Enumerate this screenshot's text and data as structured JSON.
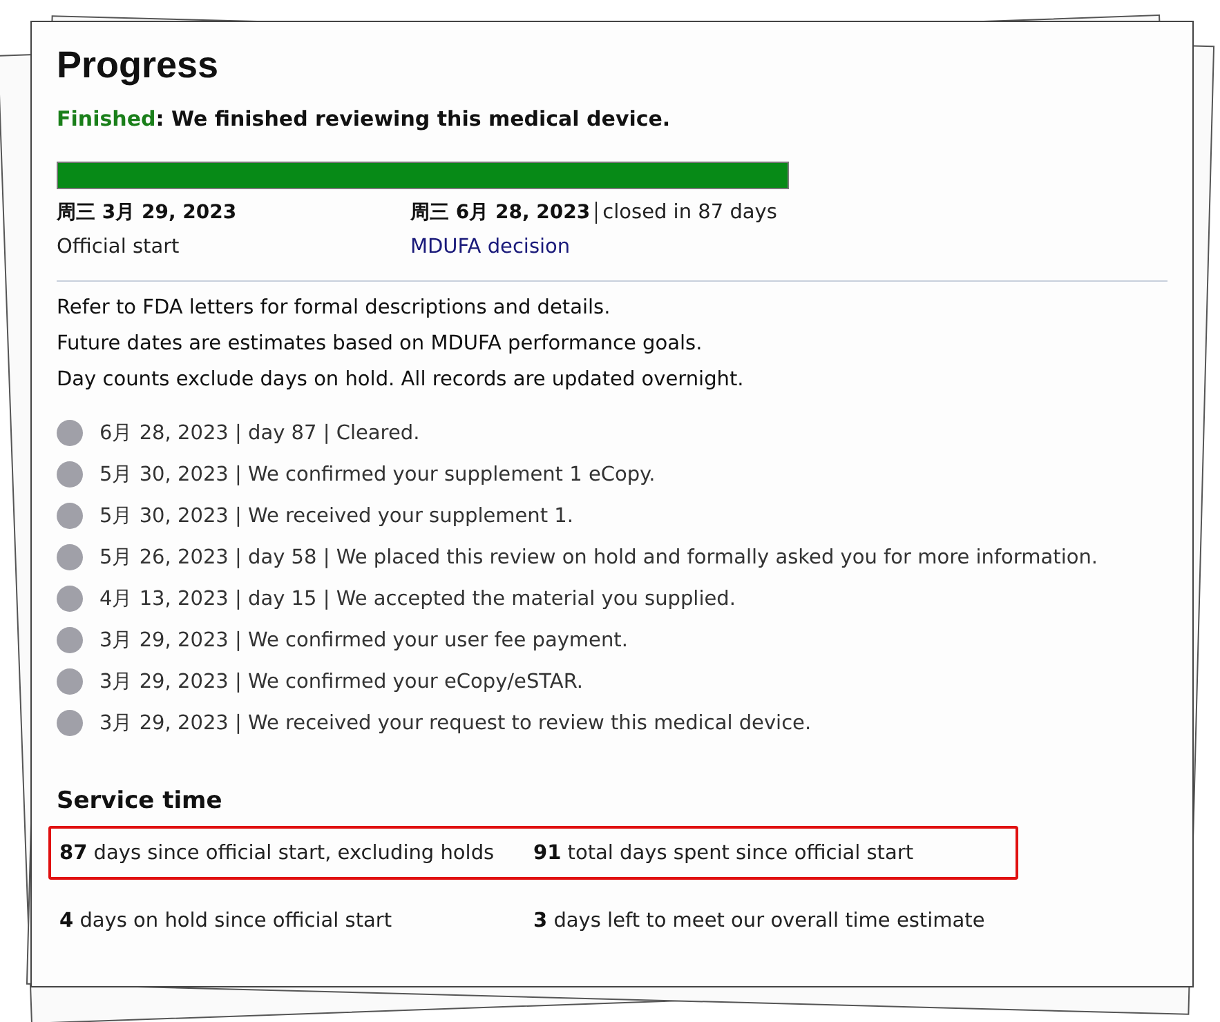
{
  "title": "Progress",
  "status": {
    "label": "Finished",
    "message": ": We finished reviewing this medical device."
  },
  "progress": {
    "level": 1
  },
  "milestones": [
    {
      "date": "周三 3月 29, 2023",
      "label": "Official start"
    },
    {
      "date": "周三 6月 28, 2023",
      "note": "closed in 87 days",
      "label": "MDUFA decision"
    }
  ],
  "notes": [
    "Refer to FDA letters for formal descriptions and details.",
    "Future dates are estimates based on MDUFA performance goals.",
    "Day counts exclude days on hold. All records are updated overnight."
  ],
  "events": [
    "6月 28, 2023 | day 87 | Cleared.",
    "5月 30, 2023 | We confirmed your supplement 1 eCopy.",
    "5月 30, 2023 | We received your supplement 1.",
    "5月 26, 2023 | day 58 | We placed this review on hold and formally asked you for more information.",
    "4月 13, 2023 | day 15 | We accepted the material you supplied.",
    "3月 29, 2023 | We confirmed your user fee payment.",
    "3月 29, 2023 | We confirmed your eCopy/eSTAR.",
    "3月 29, 2023 | We received your request to review this medical device."
  ],
  "service_time": {
    "heading": "Service time",
    "rows": [
      {
        "highlighted": true,
        "stats": [
          {
            "number": "87",
            "text": "days since official start, excluding holds"
          },
          {
            "number": "91",
            "text": "total days spent since official start"
          }
        ]
      },
      {
        "highlighted": false,
        "stats": [
          {
            "number": "4",
            "text": "days on hold since official start"
          },
          {
            "number": "3",
            "text": "days left to meet our overall time estimate"
          }
        ]
      }
    ]
  }
}
